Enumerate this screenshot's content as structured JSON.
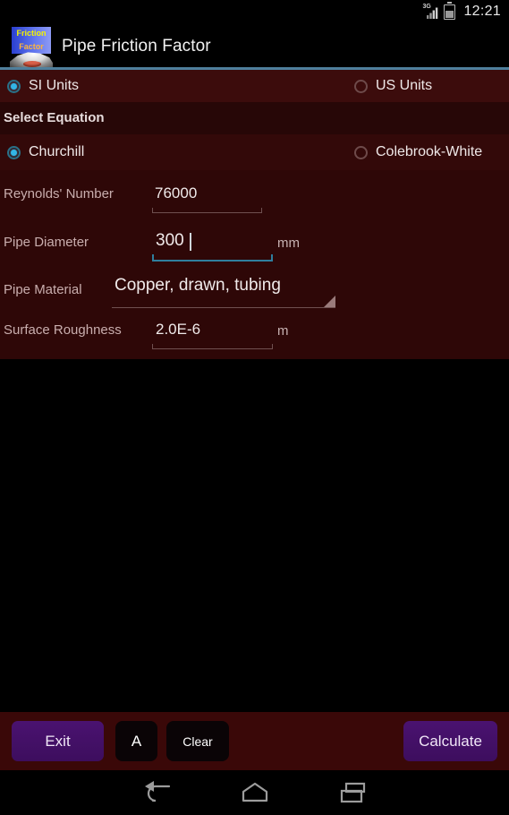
{
  "statusbar": {
    "network_label": "3G",
    "time": "12:21",
    "signal_icon": "signal-3g-icon",
    "battery_icon": "battery-charging-icon"
  },
  "actionbar": {
    "title": "Pipe Friction Factor",
    "icon_line1": "Friction",
    "icon_line2": "Factor",
    "divider_color": "#4f7f9c"
  },
  "units": {
    "options": [
      {
        "label": "SI Units",
        "selected": true
      },
      {
        "label": "US Units",
        "selected": false
      }
    ],
    "selected_color": "#33b5e5"
  },
  "equation": {
    "section_label": "Select Equation",
    "options": [
      {
        "label": "Churchill",
        "selected": true
      },
      {
        "label": "Colebrook-White",
        "selected": false
      }
    ]
  },
  "form": {
    "fields": [
      {
        "label": "Reynolds' Number",
        "value": "76000",
        "unit": "",
        "focused": false,
        "type": "text"
      },
      {
        "label": "Pipe Diameter",
        "value": "300",
        "unit": "mm",
        "focused": true,
        "type": "text"
      },
      {
        "label": "Pipe Material",
        "value": "Copper, drawn, tubing",
        "unit": "",
        "focused": false,
        "type": "spinner"
      },
      {
        "label": "Surface Roughness",
        "value": "2.0E-6",
        "unit": "m",
        "focused": false,
        "type": "text"
      }
    ]
  },
  "buttons": {
    "exit": "Exit",
    "about": "A",
    "clear": "Clear",
    "calculate": "Calculate",
    "accent_color": "#4a1270"
  },
  "navbar": {
    "back": "back-icon",
    "home": "home-icon",
    "recents": "recents-icon"
  }
}
